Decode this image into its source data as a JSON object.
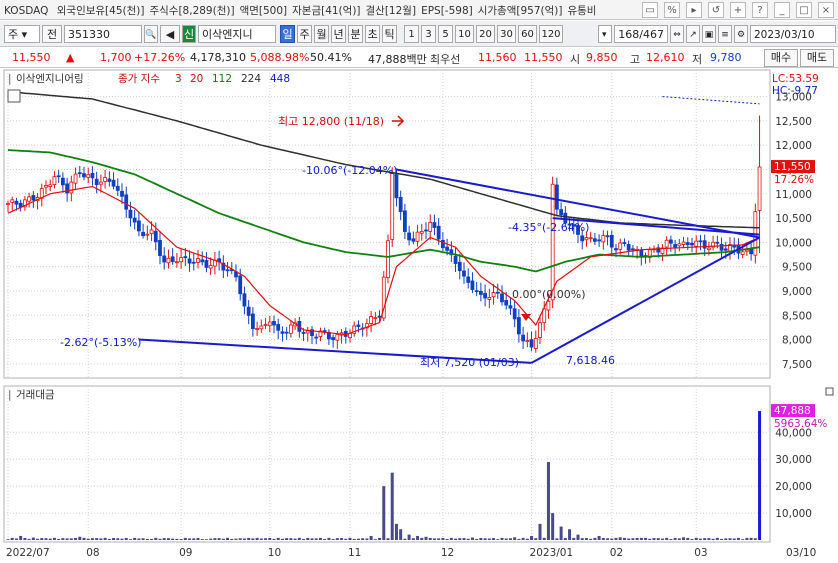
{
  "infobar": {
    "market": "KOSDAQ",
    "items": [
      "외국인보유[45(천)]",
      "주식수[8,289(천)]",
      "액면[500]",
      "자본금[41(억)]",
      "결산[12월]",
      "EPS[-598]",
      "시가총액[957(억)]",
      "유통비"
    ],
    "icons": [
      "window-icon",
      "ratio-icon",
      "forward-icon",
      "restore-icon",
      "plus-icon",
      "help-icon",
      "minimize-icon",
      "maximize-icon",
      "close-icon"
    ]
  },
  "toolbar": {
    "market_select": "주",
    "prev_label": "전",
    "code": "351330",
    "new_badge": "신",
    "stock_name": "이삭엔지니",
    "periods": [
      "일",
      "주",
      "월",
      "년",
      "분",
      "초",
      "틱"
    ],
    "active_period": "일",
    "intervals": [
      "1",
      "3",
      "5",
      "10",
      "20",
      "30",
      "60",
      "120"
    ],
    "page_counter": "168/467",
    "date": "2023/03/10",
    "buy_label": "매수",
    "sell_label": "매도"
  },
  "pricebar": {
    "price": "11,550",
    "change_arrow": "▲",
    "change": "1,700",
    "change_pct": "+17.26%",
    "volume": "4,178,310",
    "volume_pct": "5,088.98%",
    "ratio": "50.41%",
    "amount": "47,888백만",
    "best_ask_label": "최우선",
    "best_ask": "11,560",
    "best_bid": "11,550",
    "open_label": "시",
    "open": "9,850",
    "high_label": "고",
    "high": "12,610",
    "low_label": "저",
    "low": "9,780"
  },
  "colors": {
    "candle_up": "#e01010",
    "candle_down": "#1040c0",
    "ma3": "#e01010",
    "ma20": "#e01010",
    "ma112": "#108010",
    "ma224": "#303030",
    "ma448": "#1020c0",
    "trendline": "#1a1ad0",
    "volume_bar": "#4a4a8a",
    "last_volume_bar": "#1a1ad0",
    "grid": "#d0d0d0",
    "price_tag": "#e01010",
    "vol_tag": "#e020e0"
  },
  "chart_data": [
    {
      "type": "candlestick",
      "stock_label": "이삭엔지니어링",
      "indicator_label": "종가 지수",
      "ma_periods": [
        "3",
        "20",
        "112",
        "224",
        "448"
      ],
      "lc_label": "LC:53.59",
      "hc_label": "HC:-9.77",
      "last_price_tag": "11,550",
      "last_pct_tag": "17.26%",
      "y_ticks": [
        "13,000",
        "12,500",
        "12,000",
        "11,500",
        "11,000",
        "10,500",
        "10,000",
        "9,500",
        "9,000",
        "8,500",
        "8,000",
        "7,500"
      ],
      "ylim": [
        7250,
        13300
      ],
      "x_ticks": [
        {
          "label": "2022/07",
          "idx": 0
        },
        {
          "label": "08",
          "idx": 19
        },
        {
          "label": "09",
          "idx": 41
        },
        {
          "label": "10",
          "idx": 62
        },
        {
          "label": "11",
          "idx": 81
        },
        {
          "label": "12",
          "idx": 103
        },
        {
          "label": "2023/01",
          "idx": 124
        },
        {
          "label": "02",
          "idx": 143
        },
        {
          "label": "03",
          "idx": 163
        },
        {
          "label": "03/10",
          "idx": 180
        }
      ],
      "annotations": {
        "high_label": "최고 12,800 (11/18)",
        "low_label": "최저 7,520 (01/03)",
        "triangle_low_value": "7,618.46",
        "channel_left_label": "-2.62°(-5.13%)",
        "channel_top_label": "-10.06°(-12.04%)",
        "triangle_top_label": "-4.35°(-2.64%)",
        "flat_label": "0.00°(0.00%)"
      },
      "trendlines": [
        {
          "idx": [
            31,
            124
          ],
          "value": [
            8000,
            7520
          ]
        },
        {
          "idx": [
            92,
            178
          ],
          "value": [
            11500,
            10100
          ]
        },
        {
          "idx": [
            129,
            178
          ],
          "value": [
            10500,
            10160
          ]
        },
        {
          "idx": [
            124,
            178
          ],
          "value": [
            7520,
            10100
          ]
        }
      ],
      "anchors": {
        "close": [
          [
            0,
            10800
          ],
          [
            3,
            10750
          ],
          [
            7,
            11000
          ],
          [
            11,
            11350
          ],
          [
            14,
            11050
          ],
          [
            17,
            11500
          ],
          [
            21,
            11250
          ],
          [
            25,
            11200
          ],
          [
            27,
            10900
          ],
          [
            29,
            10600
          ],
          [
            31,
            10200
          ],
          [
            34,
            10150
          ],
          [
            37,
            9600
          ],
          [
            40,
            9700
          ],
          [
            43,
            9600
          ],
          [
            46,
            9550
          ],
          [
            48,
            9550
          ],
          [
            50,
            9650
          ],
          [
            52,
            9400
          ],
          [
            54,
            9300
          ],
          [
            56,
            8600
          ],
          [
            58,
            8300
          ],
          [
            60,
            8250
          ],
          [
            62,
            8450
          ],
          [
            64,
            8100
          ],
          [
            66,
            8150
          ],
          [
            68,
            8300
          ],
          [
            70,
            8200
          ],
          [
            72,
            8100
          ],
          [
            74,
            8150
          ],
          [
            76,
            8000
          ],
          [
            78,
            8050
          ],
          [
            80,
            8150
          ],
          [
            82,
            8250
          ],
          [
            85,
            8300
          ],
          [
            88,
            8500
          ],
          [
            90,
            10000
          ],
          [
            91,
            11500
          ],
          [
            92,
            11000
          ],
          [
            94,
            10200
          ],
          [
            96,
            10000
          ],
          [
            98,
            10200
          ],
          [
            100,
            10400
          ],
          [
            102,
            10150
          ],
          [
            104,
            9800
          ],
          [
            106,
            9600
          ],
          [
            108,
            9200
          ],
          [
            110,
            9100
          ],
          [
            112,
            8900
          ],
          [
            114,
            8950
          ],
          [
            116,
            8900
          ],
          [
            118,
            8700
          ],
          [
            120,
            8400
          ],
          [
            122,
            8000
          ],
          [
            124,
            7900
          ],
          [
            126,
            8300
          ],
          [
            128,
            8800
          ],
          [
            129,
            11200
          ],
          [
            130,
            10600
          ],
          [
            132,
            10500
          ],
          [
            134,
            10300
          ],
          [
            136,
            10100
          ],
          [
            138,
            10000
          ],
          [
            140,
            10050
          ],
          [
            142,
            10100
          ],
          [
            144,
            9900
          ],
          [
            146,
            10000
          ],
          [
            148,
            9800
          ],
          [
            150,
            9700
          ],
          [
            152,
            9800
          ],
          [
            154,
            9900
          ],
          [
            156,
            10000
          ],
          [
            158,
            9950
          ],
          [
            160,
            9900
          ],
          [
            162,
            10000
          ],
          [
            164,
            10000
          ],
          [
            166,
            9950
          ],
          [
            168,
            9950
          ],
          [
            170,
            9800
          ],
          [
            172,
            9900
          ],
          [
            174,
            9800
          ],
          [
            176,
            9850
          ],
          [
            178,
            11550
          ]
        ],
        "ma20": [
          [
            0,
            10600
          ],
          [
            10,
            11000
          ],
          [
            20,
            11150
          ],
          [
            30,
            10700
          ],
          [
            40,
            9900
          ],
          [
            50,
            9600
          ],
          [
            56,
            9300
          ],
          [
            62,
            8700
          ],
          [
            70,
            8200
          ],
          [
            80,
            8100
          ],
          [
            88,
            8350
          ],
          [
            92,
            9500
          ],
          [
            100,
            10100
          ],
          [
            106,
            9900
          ],
          [
            112,
            9300
          ],
          [
            120,
            8800
          ],
          [
            125,
            8300
          ],
          [
            130,
            9200
          ],
          [
            138,
            9700
          ],
          [
            150,
            9850
          ],
          [
            162,
            9900
          ],
          [
            174,
            9950
          ],
          [
            178,
            10100
          ]
        ],
        "ma112": [
          [
            0,
            11900
          ],
          [
            10,
            11850
          ],
          [
            20,
            11650
          ],
          [
            30,
            11400
          ],
          [
            40,
            11000
          ],
          [
            50,
            10600
          ],
          [
            60,
            10300
          ],
          [
            70,
            10000
          ],
          [
            80,
            9800
          ],
          [
            90,
            9700
          ],
          [
            100,
            9850
          ],
          [
            106,
            9750
          ],
          [
            112,
            9600
          ],
          [
            120,
            9500
          ],
          [
            125,
            9400
          ],
          [
            132,
            9600
          ],
          [
            140,
            9750
          ],
          [
            150,
            9700
          ],
          [
            160,
            9750
          ],
          [
            170,
            9800
          ],
          [
            178,
            9900
          ]
        ],
        "ma224": [
          [
            0,
            13100
          ],
          [
            20,
            12950
          ],
          [
            40,
            12500
          ],
          [
            60,
            12000
          ],
          [
            80,
            11600
          ],
          [
            100,
            11300
          ],
          [
            120,
            10800
          ],
          [
            130,
            10550
          ],
          [
            145,
            10400
          ],
          [
            160,
            10350
          ],
          [
            178,
            10300
          ]
        ],
        "ma448": [
          [
            155,
            13000
          ],
          [
            178,
            12850
          ]
        ]
      }
    },
    {
      "type": "bar",
      "title": "거래대금",
      "last_value_tag": "47,888",
      "last_pct_tag": "5963.64%",
      "y_ticks": [
        "40,000",
        "30,000",
        "20,000",
        "10,000"
      ],
      "ylim": [
        0,
        52000
      ],
      "spikes": [
        [
          3,
          1500
        ],
        [
          6,
          900
        ],
        [
          13,
          700
        ],
        [
          17,
          1200
        ],
        [
          22,
          600
        ],
        [
          27,
          500
        ],
        [
          33,
          400
        ],
        [
          40,
          400
        ],
        [
          47,
          300
        ],
        [
          54,
          500
        ],
        [
          58,
          600
        ],
        [
          63,
          400
        ],
        [
          70,
          400
        ],
        [
          77,
          350
        ],
        [
          83,
          500
        ],
        [
          86,
          1500
        ],
        [
          89,
          20000
        ],
        [
          91,
          25000
        ],
        [
          92,
          6000
        ],
        [
          93,
          4000
        ],
        [
          95,
          2000
        ],
        [
          97,
          1500
        ],
        [
          99,
          1200
        ],
        [
          110,
          900
        ],
        [
          115,
          700
        ],
        [
          120,
          1000
        ],
        [
          124,
          1500
        ],
        [
          126,
          6000
        ],
        [
          128,
          29000
        ],
        [
          129,
          10000
        ],
        [
          131,
          5000
        ],
        [
          133,
          4000
        ],
        [
          135,
          2000
        ],
        [
          140,
          1500
        ],
        [
          145,
          1000
        ],
        [
          150,
          800
        ],
        [
          160,
          1000
        ],
        [
          170,
          600
        ],
        [
          176,
          800
        ],
        [
          178,
          47888
        ]
      ]
    }
  ]
}
